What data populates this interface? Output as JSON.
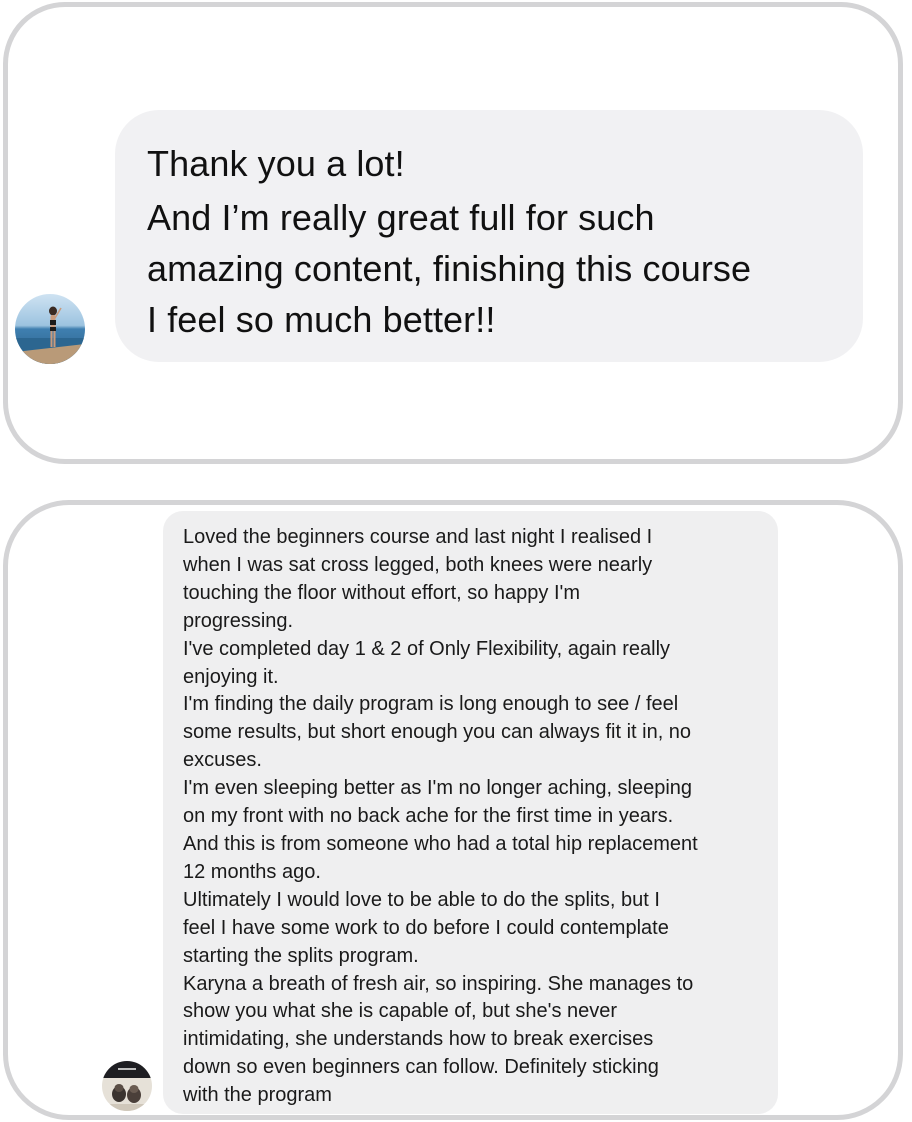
{
  "message_1": {
    "lines": [
      "Thank you a lot!",
      "And I’m really great full for such",
      "amazing content, finishing this course",
      "I feel so much better!!"
    ]
  },
  "message_2": {
    "lines": [
      "Loved the beginners course and last night I realised I",
      "when I was sat cross legged, both knees were nearly",
      "touching the floor without effort, so happy I'm",
      "progressing.",
      "I've completed day 1 & 2 of Only Flexibility, again really",
      "enjoying it.",
      "I'm finding the daily program is long enough to see / feel",
      "some results, but short enough you can always fit it in, no",
      "excuses.",
      "I'm even sleeping better as I'm no longer aching, sleeping",
      "on my front with no back ache for the first time in years.",
      "And this is from someone who had a total hip replacement",
      "12 months ago.",
      "Ultimately I would love to be able to do the splits, but I",
      "feel I have some work to do before I could contemplate",
      "starting the splits program.",
      "Karyna a breath of fresh air,  so inspiring. She manages to",
      "show you what she is capable of, but she's never",
      "intimidating, she understands how to break exercises",
      "down so even beginners can follow. Definitely sticking",
      "with the program"
    ]
  },
  "colors": {
    "card_border": "#d4d4d6",
    "bubble_bg": "#f1f1f3",
    "text": "#111111"
  }
}
